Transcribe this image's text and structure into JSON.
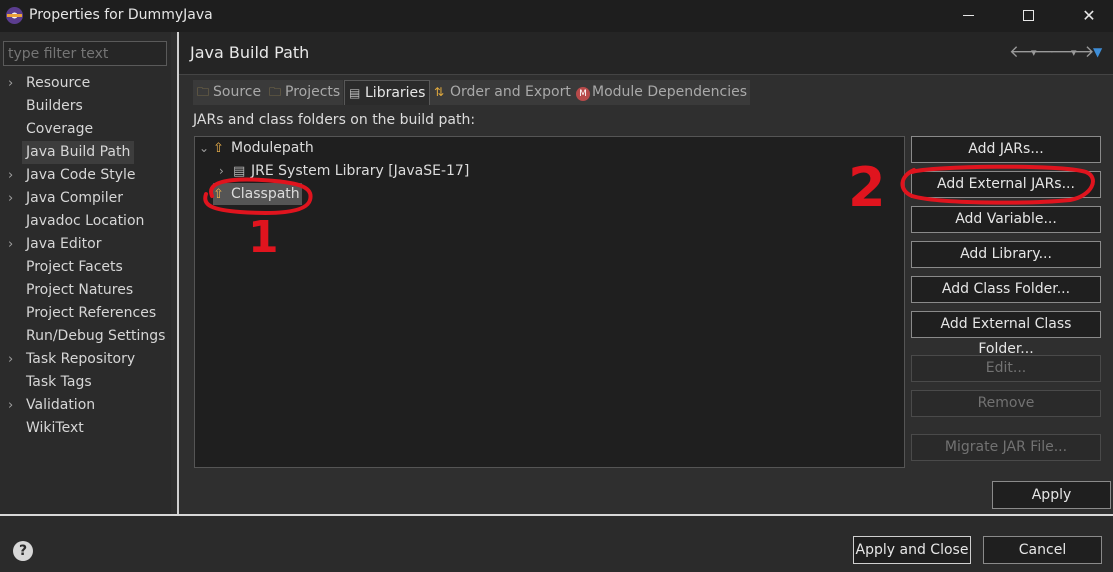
{
  "window": {
    "title": "Properties for DummyJava"
  },
  "filter": {
    "placeholder": "type filter text"
  },
  "nav": {
    "items": [
      {
        "label": "Resource",
        "expandable": true
      },
      {
        "label": "Builders",
        "expandable": false
      },
      {
        "label": "Coverage",
        "expandable": false
      },
      {
        "label": "Java Build Path",
        "expandable": false,
        "selected": true
      },
      {
        "label": "Java Code Style",
        "expandable": true
      },
      {
        "label": "Java Compiler",
        "expandable": true
      },
      {
        "label": "Javadoc Location",
        "expandable": false
      },
      {
        "label": "Java Editor",
        "expandable": true
      },
      {
        "label": "Project Facets",
        "expandable": false
      },
      {
        "label": "Project Natures",
        "expandable": false
      },
      {
        "label": "Project References",
        "expandable": false
      },
      {
        "label": "Run/Debug Settings",
        "expandable": false
      },
      {
        "label": "Task Repository",
        "expandable": true
      },
      {
        "label": "Task Tags",
        "expandable": false
      },
      {
        "label": "Validation",
        "expandable": true
      },
      {
        "label": "WikiText",
        "expandable": false
      }
    ]
  },
  "page": {
    "title": "Java Build Path",
    "tabs": [
      {
        "label": "Source"
      },
      {
        "label": "Projects"
      },
      {
        "label": "Libraries",
        "active": true
      },
      {
        "label": "Order and Export"
      },
      {
        "label": "Module Dependencies"
      }
    ],
    "section_label": "JARs and class folders on the build path:",
    "tree": {
      "modulepath": "Modulepath",
      "jre": "JRE System Library [JavaSE-17]",
      "classpath": "Classpath"
    },
    "buttons": {
      "add_jars": "Add JARs...",
      "add_external_jars": "Add External JARs...",
      "add_variable": "Add Variable...",
      "add_library": "Add Library...",
      "add_class_folder": "Add Class Folder...",
      "add_external_class_folder": "Add External Class Folder...",
      "edit": "Edit...",
      "remove": "Remove",
      "migrate_jar": "Migrate JAR File..."
    },
    "apply": "Apply"
  },
  "footer": {
    "apply_and_close": "Apply and Close",
    "cancel": "Cancel"
  },
  "annotations": {
    "label_1": "1",
    "label_2": "2",
    "color": "#e0141e"
  }
}
